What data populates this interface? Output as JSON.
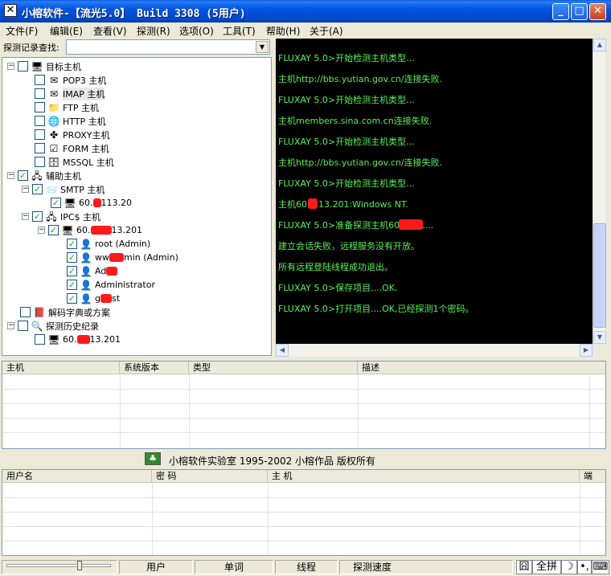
{
  "window": {
    "title": "小榕软件-【流光5.0】 Build 3308 (5用户)",
    "controls": {
      "minimize": "_",
      "maximize": "□",
      "close": "✕"
    }
  },
  "menu": [
    "文件(F)",
    "编辑(E)",
    "查看(V)",
    "探测(R)",
    "选项(O)",
    "工具(T)",
    "帮助(H)",
    "关于(A)"
  ],
  "search": {
    "label": "探测记录查找:",
    "value": ""
  },
  "tree": {
    "target_root": "目标主机",
    "targets": [
      "POP3 主机",
      "IMAP 主机",
      "FTP 主机",
      "HTTP 主机",
      "PROXY主机",
      "FORM 主机",
      "MSSQL 主机"
    ],
    "aux_root": "辅助主机",
    "smtp": "SMTP 主机",
    "smtp_host": {
      "a": "60.",
      "b": "113.20"
    },
    "ipc": "IPC$ 主机",
    "ipc_host": {
      "a": "60.",
      "b": "13.201"
    },
    "users": [
      {
        "a": "root (Admin)",
        "b": ""
      },
      {
        "a": "ww",
        "b": "min (Admin)"
      },
      {
        "a": "Ad",
        "b": ""
      },
      {
        "a": "Administrator",
        "b": ""
      },
      {
        "a": "g",
        "b": "st"
      }
    ],
    "dict_root": "解码字典或方案",
    "history_root": "探测历史纪录",
    "history_host": {
      "a": "60.",
      "b": "13.201"
    }
  },
  "console": [
    "FLUXAY 5.0>开始检测主机类型...",
    "主机http://bbs.yutian.gov.cn/连接失败.",
    "FLUXAY 5.0>开始检测主机类型...",
    "主机members.sina.com.cn连接失败.",
    "FLUXAY 5.0>开始检测主机类型...",
    "主机http://bbs.yutian.gov.cn/连接失败.",
    "FLUXAY 5.0>开始检测主机类型...",
    "主机60.    113.201:Windows NT.",
    "FLUXAY 5.0>准备探测主机60.      .201...",
    "建立会话失败，远程服务没有开放。",
    "所有远程登陆线程成功退出。",
    "FLUXAY 5.0>保存项目....OK.",
    "FLUXAY 5.0>打开项目....OK,已经探测1个密码。"
  ],
  "host_table": {
    "columns": [
      "主机",
      "系统版本",
      "类型",
      "描述"
    ]
  },
  "copyright": "小榕软件实验室 1995-2002 小榕作品 版权所有",
  "user_table": {
    "columns": [
      "用户名",
      "密 码",
      "主 机",
      "端"
    ]
  },
  "status": {
    "panels": [
      "用户",
      "单词",
      "线程",
      "探测速度"
    ],
    "ime_mode": "全拼"
  },
  "colors": {
    "console_text": "#58f058",
    "console_bg": "#000000",
    "redaction": "#ff1a1a"
  }
}
